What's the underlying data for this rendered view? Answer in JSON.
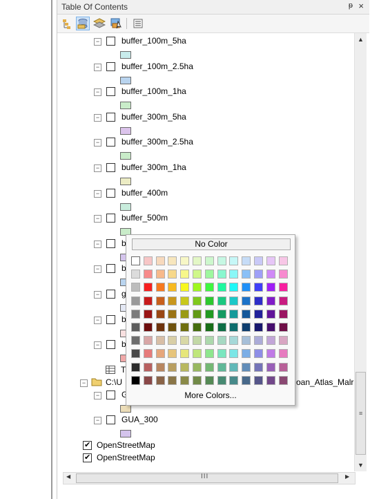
{
  "window": {
    "title": "Table Of Contents",
    "pin_glyph": "ᵽ",
    "close_glyph": "×"
  },
  "toolbar": {
    "icons": [
      "list-by-drawing-order-icon",
      "list-by-source-icon",
      "list-by-visibility-icon",
      "list-by-selection-icon",
      "options-icon"
    ]
  },
  "layers": [
    {
      "label": "buffer_100m_5ha",
      "checked": false,
      "swatch": "#c8ecec"
    },
    {
      "label": "buffer_100m_2.5ha",
      "checked": false,
      "swatch": "#b9d4ef"
    },
    {
      "label": "buffer_100m_1ha",
      "checked": false,
      "swatch": "#c9ecc9"
    },
    {
      "label": "buffer_300m_5ha",
      "checked": false,
      "swatch": "#dcc4ec"
    },
    {
      "label": "buffer_300m_2.5ha",
      "checked": false,
      "swatch": "#c9ecc9"
    },
    {
      "label": "buffer_300m_1ha",
      "checked": false,
      "swatch": "#ececc4"
    },
    {
      "label": "buffer_400m",
      "checked": false,
      "swatch": "#c8ecdc"
    },
    {
      "label": "buffer_500m",
      "checked": false,
      "swatch": "#c9ecc9"
    },
    {
      "label": "b",
      "checked": false,
      "swatch": "#d4c4ec"
    },
    {
      "label": "b",
      "checked": false,
      "swatch": "#b9d4ef"
    },
    {
      "label": "g",
      "checked": false,
      "swatch": "#e4e8f4"
    },
    {
      "label": "b",
      "checked": false,
      "swatch": "#f8e0e0"
    },
    {
      "label": "b",
      "checked": false,
      "swatch": "#f0a8a8"
    }
  ],
  "table_item": {
    "label": "T"
  },
  "group": {
    "prefix": "C:\\U",
    "suffix": "oan_Atlas_Malr"
  },
  "group_layers": [
    {
      "label": "G",
      "checked": false,
      "swatch": "#ecddb8"
    },
    {
      "label": "GUA_300",
      "checked": false,
      "swatch": "#d4c4ec"
    }
  ],
  "basemaps": [
    {
      "label": "OpenStreetMap",
      "checked": true
    },
    {
      "label": "OpenStreetMap",
      "checked": true
    }
  ],
  "scroll": {
    "h_grip": "III"
  },
  "color_picker": {
    "no_color_label": "No Color",
    "more_colors_label": "More Colors...",
    "rows": [
      [
        "#ffffff",
        "#f7c6c6",
        "#f7d9bd",
        "#f7e6bd",
        "#f7f7c6",
        "#e3f7c6",
        "#cdf7cd",
        "#c6f7e3",
        "#c6f7f7",
        "#c6dcf7",
        "#c9c9f7",
        "#e6c6f7",
        "#f7c6e6"
      ],
      [
        "#dcdcdc",
        "#f78a8a",
        "#f7b98a",
        "#f7d88a",
        "#f7f78a",
        "#cff78a",
        "#9ef79e",
        "#8af7cf",
        "#8af7f7",
        "#8ac0f7",
        "#9f9ff7",
        "#cf8af7",
        "#f78acf"
      ],
      [
        "#bcbcbc",
        "#f71f1f",
        "#f7791f",
        "#f7b91f",
        "#f7f71f",
        "#9ff71f",
        "#3ff73f",
        "#1ff79f",
        "#1ff7f7",
        "#1f8ff7",
        "#3f3ff7",
        "#9f1ff7",
        "#f71f9f"
      ],
      [
        "#9a9a9a",
        "#c81c1c",
        "#c8601c",
        "#c8961c",
        "#c8c81c",
        "#80c81c",
        "#2ec82e",
        "#1cc880",
        "#1cc8c8",
        "#1c72c8",
        "#2e2ec8",
        "#801cc8",
        "#c81c80"
      ],
      [
        "#7c7c7c",
        "#9a1515",
        "#9a4815",
        "#9a7315",
        "#9a9a15",
        "#629a15",
        "#229a22",
        "#159a62",
        "#159a9a",
        "#15589a",
        "#22229a",
        "#62159a",
        "#9a1562"
      ],
      [
        "#5c5c5c",
        "#6e0e0e",
        "#6e330e",
        "#6e520e",
        "#6e6e0e",
        "#466e0e",
        "#186e18",
        "#0e6e46",
        "#0e6e6e",
        "#0e3e6e",
        "#18186e",
        "#460e6e",
        "#6e0e46"
      ],
      [
        "#6c6c6c",
        "#d8a6a6",
        "#d8bea6",
        "#d8cea6",
        "#d8d8a6",
        "#c2d8a6",
        "#acd8ac",
        "#a6d8c2",
        "#a6d8d8",
        "#a6bfd8",
        "#acacd8",
        "#c2a6d8",
        "#d8a6c2"
      ],
      [
        "#4a4a4a",
        "#e67b7b",
        "#e6a67b",
        "#e6c47b",
        "#e6e67b",
        "#bfe67b",
        "#8ee68e",
        "#7be6bf",
        "#7be6e6",
        "#7baee6",
        "#8e8ee6",
        "#bf7be6",
        "#e67bbf"
      ],
      [
        "#2c2c2c",
        "#b86060",
        "#b88660",
        "#b89e60",
        "#b8b860",
        "#98b860",
        "#74b874",
        "#60b898",
        "#60b8b8",
        "#608cb8",
        "#7474b8",
        "#9860b8",
        "#b86098"
      ],
      [
        "#000000",
        "#8a4848",
        "#8a6448",
        "#8a7648",
        "#8a8a48",
        "#728a48",
        "#568a56",
        "#488a72",
        "#488a8a",
        "#48698a",
        "#56568a",
        "#72488a",
        "#8a4872"
      ]
    ]
  }
}
